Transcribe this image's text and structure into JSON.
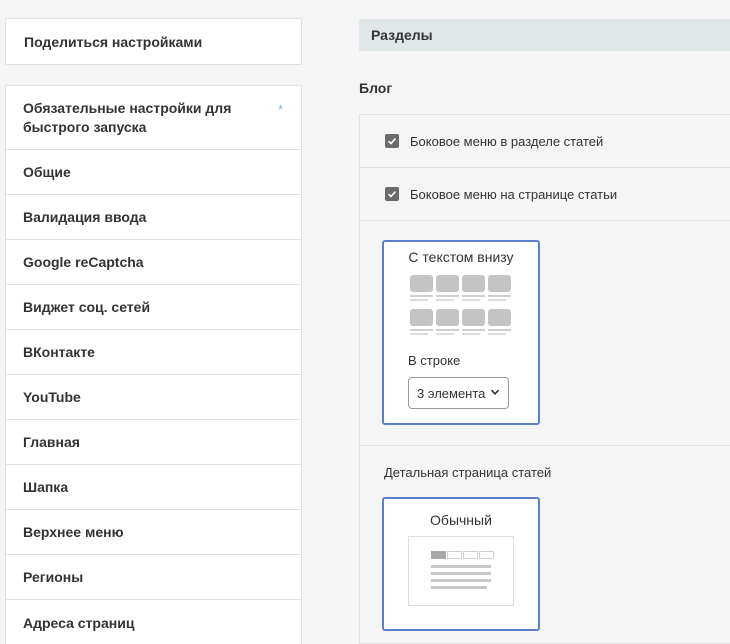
{
  "sidebar": {
    "share_label": "Поделиться настройками",
    "items": [
      {
        "label": "Обязательные настройки для быстрого запуска",
        "marker": "*"
      },
      {
        "label": "Общие"
      },
      {
        "label": "Валидация ввода"
      },
      {
        "label": "Google reCaptcha"
      },
      {
        "label": "Виджет соц. сетей"
      },
      {
        "label": "ВКонтакте"
      },
      {
        "label": "YouTube"
      },
      {
        "label": "Главная"
      },
      {
        "label": "Шапка"
      },
      {
        "label": "Верхнее меню"
      },
      {
        "label": "Регионы"
      },
      {
        "label": "Адреса страниц"
      }
    ]
  },
  "main": {
    "section_title": "Разделы",
    "group_title": "Блог",
    "options": [
      {
        "label": "Боковое меню в разделе статей",
        "checked": true
      },
      {
        "label": "Боковое меню на странице статьи",
        "checked": true
      }
    ],
    "list_view": {
      "title": "С текстом внизу",
      "per_row_label": "В строке",
      "per_row_value": "3 элемента"
    },
    "detail": {
      "label": "Детальная страница статей",
      "card_title": "Обычный"
    }
  },
  "colors": {
    "accent_border": "#5b80c8",
    "header_bg": "#e1e6e9",
    "star": "#7fb4d8"
  },
  "icons": {
    "checkbox": "checkmark-icon",
    "select": "chevron-down-icon",
    "required": "asterisk-icon"
  }
}
